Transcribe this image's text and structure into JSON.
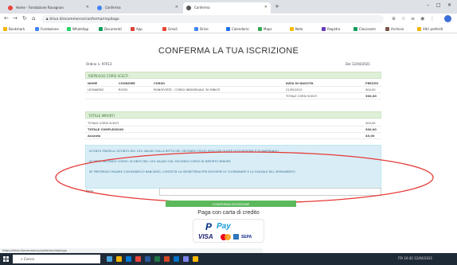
{
  "browser": {
    "tabs": [
      {
        "label": "Home - Fondazione Ravagnan",
        "active": false,
        "favicon_color": "#e8453c"
      },
      {
        "label": "Conferma",
        "active": false,
        "favicon_color": "#4285f4"
      },
      {
        "label": "Conferma",
        "active": true,
        "favicon_color": "#555555"
      }
    ],
    "new_tab": "+",
    "url": "driva.it/ecommerce/conferma/riepilogo",
    "bookmarks": [
      {
        "label": "Bookmark",
        "color": "#f4b400"
      },
      {
        "label": "Fondazione",
        "color": "#4285f4"
      },
      {
        "label": "WhatsApp",
        "color": "#25d366"
      },
      {
        "label": "Documenti",
        "color": "#0f9d58"
      },
      {
        "label": "App",
        "color": "#db4437"
      },
      {
        "label": "Gmail",
        "color": "#ea4335"
      },
      {
        "label": "Drive",
        "color": "#4285f4"
      },
      {
        "label": "Calendario",
        "color": "#1a73e8"
      },
      {
        "label": "Maps",
        "color": "#34a853"
      },
      {
        "label": "Note",
        "color": "#fbbc04"
      },
      {
        "label": "Registro",
        "color": "#673ab7"
      },
      {
        "label": "Classroom",
        "color": "#0f9d58"
      },
      {
        "label": "Archivio",
        "color": "#795548"
      },
      {
        "label": "Altri preferiti",
        "color": "#f4b400"
      }
    ]
  },
  "page": {
    "title": "CONFERMA LA TUA ISCRIZIONE",
    "order_no": "Ordine n. 97013",
    "order_date": "Del 12/04/2021",
    "riepilogo": {
      "header": "RIEPILOGO CORSI SCELTI",
      "columns": [
        "NOME",
        "COGNOME",
        "CORSO",
        "DATA DI NASCITA",
        "PREZZO"
      ],
      "rows": [
        [
          "LEONARDO",
          "ROSSI",
          "PIANOFORTE - CORSO INDIVIDUALE 30 MINUTI",
          "21/05/2012",
          "300,00"
        ]
      ],
      "total_label": "TOTALE CORSI SCELTI",
      "total_value": "300,00"
    },
    "totali": {
      "header": "TOTALE IMPORTI",
      "rows": [
        {
          "label": "TOTALE CORSI SCELTI",
          "value": "300,00"
        },
        {
          "label": "TOTALE COMPLESSIVO",
          "value": "300,00"
        },
        {
          "label": "Acconto",
          "value": "45,00"
        }
      ]
    },
    "info_lines": [
      "SCONTO FRATELLI: SCONTO DEL 10% VALIDO SULLA RETTA DEL SECONDO FIGLIO (ESCLUSE QUOTE DI ISCRIZIONE E DI MATERIALE)",
      "SCONTO SECONDO CORSO: SCONTO DEL 10% VALIDO SUL SECONDO CORSO DI IMPORTO MINORE",
      "SE PREFERISCI PAGARE CON BONIFICO BANCARIO, CONTATTA LA SEGRETERIA PER RICEVERE LE COORDINATE E LA CAUSALE DEL VERSAMENTO"
    ],
    "note_label": "Note",
    "note_placeholder": "",
    "confirm_button": "CONFERMA ISCRIZIONE",
    "pay_text": "Paga con carta di credito",
    "paypal": {
      "logo": "P",
      "word": "Pay",
      "visa": "VISA",
      "sepa": "SEPA"
    }
  },
  "status_url": "https://driva.it/ecommerce/conferma/riepilogo",
  "taskbar": {
    "search_placeholder": "Cerca",
    "tray": "ITA  10:42  12/04/2021"
  },
  "colors": {
    "highlight_ellipse": "#e53935",
    "panel_green": "#dff0d8",
    "info_blue": "#d9edf7"
  }
}
